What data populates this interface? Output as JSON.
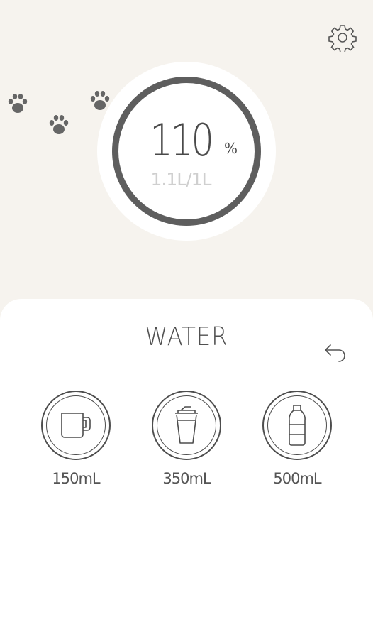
{
  "header": {
    "settings_icon": "gear-icon"
  },
  "progress": {
    "percent_value": "110",
    "percent_sign": "%",
    "volume_text": "1.1L/1L",
    "fraction": 1.1,
    "ring_color": "#5e5e5e"
  },
  "decorations": {
    "paw_icon": "paw-print-icon",
    "paw_color": "#666666"
  },
  "panel": {
    "title": "WATER",
    "undo_icon": "undo-arrow-icon",
    "options": [
      {
        "label": "150mL",
        "icon": "mug-icon"
      },
      {
        "label": "350mL",
        "icon": "cup-icon"
      },
      {
        "label": "500mL",
        "icon": "bottle-icon"
      }
    ]
  },
  "colors": {
    "background": "#f6f3ee",
    "panel": "#ffffff",
    "stroke": "#4d4d4d"
  }
}
